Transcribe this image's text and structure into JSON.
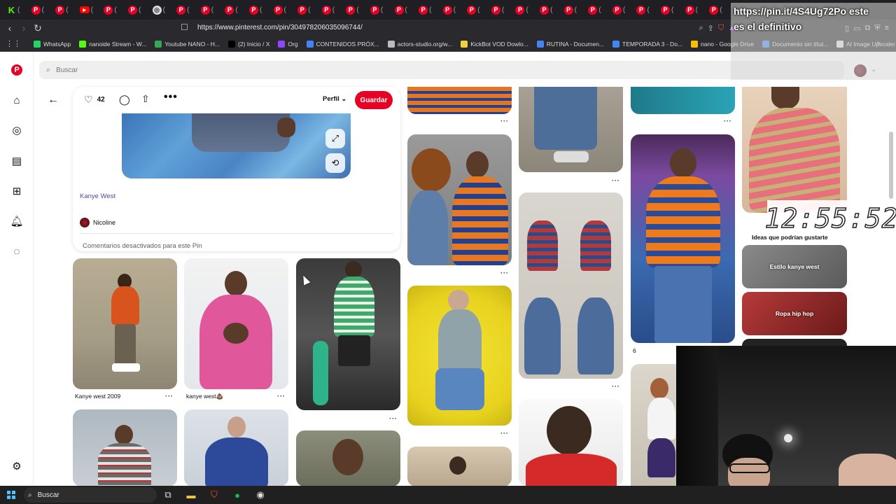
{
  "browser": {
    "url": "https://www.pinterest.com/pin/304978206035096744/",
    "tab_icons": [
      "kick-icon",
      "pinterest-icon",
      "pinterest-icon",
      "youtube-icon",
      "pinterest-icon",
      "pinterest-icon",
      "chrome-icon",
      "pinterest-icon",
      "pinterest-icon",
      "pinterest-icon",
      "pinterest-icon",
      "pinterest-icon",
      "pinterest-icon",
      "pinterest-icon",
      "pinterest-icon",
      "pinterest-icon",
      "pinterest-icon",
      "pinterest-icon",
      "pinterest-icon",
      "pinterest-icon",
      "pinterest-icon",
      "pinterest-icon",
      "pinterest-icon",
      "pinterest-icon",
      "pinterest-icon",
      "pinterest-icon",
      "pinterest-icon",
      "pinterest-icon",
      "pinterest-icon",
      "pinterest-icon"
    ],
    "bookmarks": [
      {
        "label": "WhatsApp",
        "color": "#25d366"
      },
      {
        "label": "nanoide Stream - W...",
        "color": "#53fc18"
      },
      {
        "label": "Youtube NANO - H...",
        "color": "#34a853"
      },
      {
        "label": "(2) Inicio / X",
        "color": "#000000"
      },
      {
        "label": "Org",
        "color": "#9146ff"
      },
      {
        "label": "CONTENIDOS PRÓX...",
        "color": "#4285f4"
      },
      {
        "label": "actors-studio.org/w...",
        "color": "#bbbbbb"
      },
      {
        "label": "KickBot VOD Dowlo...",
        "color": "#f4d03f"
      },
      {
        "label": "RUTINA - Documen...",
        "color": "#4285f4"
      },
      {
        "label": "TEMPORADA 3 - Do...",
        "color": "#4285f4"
      },
      {
        "label": "nano - Google Drive",
        "color": "#fbbc04"
      },
      {
        "label": "Documento sin títul...",
        "color": "#4285f4"
      },
      {
        "label": "AI Image Upscaler |...",
        "color": "#dddddd"
      }
    ]
  },
  "overlay": {
    "line1": "https://pin.it/4S4Ug72Po este",
    "line2": "es el definitivo",
    "clock": "12:55:52"
  },
  "search": {
    "placeholder": "Buscar"
  },
  "pin": {
    "likes": "42",
    "profile_label": "Perfil",
    "save_label": "Guardar",
    "title": "Kanye West",
    "creator": "Nicoline",
    "comments_note": "Comentarios desactivados para este Pin"
  },
  "grid": {
    "captions": {
      "kanye_2009": "Kanye west 2009",
      "kanye_pink": "kanye west💩",
      "count_6": "6"
    }
  },
  "side": {
    "title": "Ideas que podrían gustarte",
    "ideas": [
      "Estilo kanye west",
      "Ropa hip hop"
    ]
  },
  "taskbar": {
    "search_label": "Buscar"
  },
  "colors": {
    "pinterest_red": "#e60023",
    "accent_link": "#4a4aa8"
  }
}
